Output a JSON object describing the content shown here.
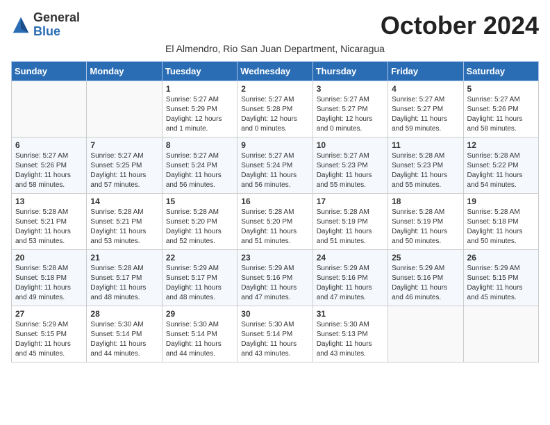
{
  "header": {
    "logo_general": "General",
    "logo_blue": "Blue",
    "month_title": "October 2024",
    "subtitle": "El Almendro, Rio San Juan Department, Nicaragua"
  },
  "days_of_week": [
    "Sunday",
    "Monday",
    "Tuesday",
    "Wednesday",
    "Thursday",
    "Friday",
    "Saturday"
  ],
  "weeks": [
    [
      {
        "day": "",
        "info": ""
      },
      {
        "day": "",
        "info": ""
      },
      {
        "day": "1",
        "info": "Sunrise: 5:27 AM\nSunset: 5:29 PM\nDaylight: 12 hours and 1 minute."
      },
      {
        "day": "2",
        "info": "Sunrise: 5:27 AM\nSunset: 5:28 PM\nDaylight: 12 hours and 0 minutes."
      },
      {
        "day": "3",
        "info": "Sunrise: 5:27 AM\nSunset: 5:27 PM\nDaylight: 12 hours and 0 minutes."
      },
      {
        "day": "4",
        "info": "Sunrise: 5:27 AM\nSunset: 5:27 PM\nDaylight: 11 hours and 59 minutes."
      },
      {
        "day": "5",
        "info": "Sunrise: 5:27 AM\nSunset: 5:26 PM\nDaylight: 11 hours and 58 minutes."
      }
    ],
    [
      {
        "day": "6",
        "info": "Sunrise: 5:27 AM\nSunset: 5:26 PM\nDaylight: 11 hours and 58 minutes."
      },
      {
        "day": "7",
        "info": "Sunrise: 5:27 AM\nSunset: 5:25 PM\nDaylight: 11 hours and 57 minutes."
      },
      {
        "day": "8",
        "info": "Sunrise: 5:27 AM\nSunset: 5:24 PM\nDaylight: 11 hours and 56 minutes."
      },
      {
        "day": "9",
        "info": "Sunrise: 5:27 AM\nSunset: 5:24 PM\nDaylight: 11 hours and 56 minutes."
      },
      {
        "day": "10",
        "info": "Sunrise: 5:27 AM\nSunset: 5:23 PM\nDaylight: 11 hours and 55 minutes."
      },
      {
        "day": "11",
        "info": "Sunrise: 5:28 AM\nSunset: 5:23 PM\nDaylight: 11 hours and 55 minutes."
      },
      {
        "day": "12",
        "info": "Sunrise: 5:28 AM\nSunset: 5:22 PM\nDaylight: 11 hours and 54 minutes."
      }
    ],
    [
      {
        "day": "13",
        "info": "Sunrise: 5:28 AM\nSunset: 5:21 PM\nDaylight: 11 hours and 53 minutes."
      },
      {
        "day": "14",
        "info": "Sunrise: 5:28 AM\nSunset: 5:21 PM\nDaylight: 11 hours and 53 minutes."
      },
      {
        "day": "15",
        "info": "Sunrise: 5:28 AM\nSunset: 5:20 PM\nDaylight: 11 hours and 52 minutes."
      },
      {
        "day": "16",
        "info": "Sunrise: 5:28 AM\nSunset: 5:20 PM\nDaylight: 11 hours and 51 minutes."
      },
      {
        "day": "17",
        "info": "Sunrise: 5:28 AM\nSunset: 5:19 PM\nDaylight: 11 hours and 51 minutes."
      },
      {
        "day": "18",
        "info": "Sunrise: 5:28 AM\nSunset: 5:19 PM\nDaylight: 11 hours and 50 minutes."
      },
      {
        "day": "19",
        "info": "Sunrise: 5:28 AM\nSunset: 5:18 PM\nDaylight: 11 hours and 50 minutes."
      }
    ],
    [
      {
        "day": "20",
        "info": "Sunrise: 5:28 AM\nSunset: 5:18 PM\nDaylight: 11 hours and 49 minutes."
      },
      {
        "day": "21",
        "info": "Sunrise: 5:28 AM\nSunset: 5:17 PM\nDaylight: 11 hours and 48 minutes."
      },
      {
        "day": "22",
        "info": "Sunrise: 5:29 AM\nSunset: 5:17 PM\nDaylight: 11 hours and 48 minutes."
      },
      {
        "day": "23",
        "info": "Sunrise: 5:29 AM\nSunset: 5:16 PM\nDaylight: 11 hours and 47 minutes."
      },
      {
        "day": "24",
        "info": "Sunrise: 5:29 AM\nSunset: 5:16 PM\nDaylight: 11 hours and 47 minutes."
      },
      {
        "day": "25",
        "info": "Sunrise: 5:29 AM\nSunset: 5:16 PM\nDaylight: 11 hours and 46 minutes."
      },
      {
        "day": "26",
        "info": "Sunrise: 5:29 AM\nSunset: 5:15 PM\nDaylight: 11 hours and 45 minutes."
      }
    ],
    [
      {
        "day": "27",
        "info": "Sunrise: 5:29 AM\nSunset: 5:15 PM\nDaylight: 11 hours and 45 minutes."
      },
      {
        "day": "28",
        "info": "Sunrise: 5:30 AM\nSunset: 5:14 PM\nDaylight: 11 hours and 44 minutes."
      },
      {
        "day": "29",
        "info": "Sunrise: 5:30 AM\nSunset: 5:14 PM\nDaylight: 11 hours and 44 minutes."
      },
      {
        "day": "30",
        "info": "Sunrise: 5:30 AM\nSunset: 5:14 PM\nDaylight: 11 hours and 43 minutes."
      },
      {
        "day": "31",
        "info": "Sunrise: 5:30 AM\nSunset: 5:13 PM\nDaylight: 11 hours and 43 minutes."
      },
      {
        "day": "",
        "info": ""
      },
      {
        "day": "",
        "info": ""
      }
    ]
  ]
}
